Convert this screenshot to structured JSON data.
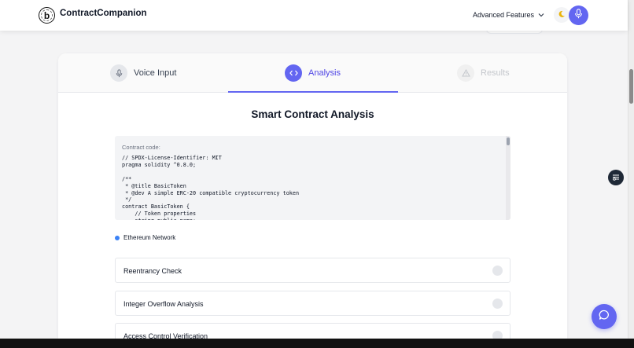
{
  "app": {
    "name": "ContractCompanion",
    "logo_letter": "b"
  },
  "header": {
    "advanced_features_label": "Advanced Features",
    "icons": [
      "chevron-down-icon",
      "moon-icon",
      "microphone-icon"
    ]
  },
  "tabs": [
    {
      "label": "Voice Input",
      "icon": "microphone-icon",
      "state": "completed"
    },
    {
      "label": "Analysis",
      "icon": "code-icon",
      "state": "active"
    },
    {
      "label": "Results",
      "icon": "warning-icon",
      "state": "disabled"
    }
  ],
  "main": {
    "title": "Smart Contract Analysis",
    "code_caption": "Contract code:",
    "code": "// SPDX-License-Identifier: MIT\npragma solidity ^0.8.0;\n\n/**\n * @title BasicToken\n * @dev A simple ERC-20 compatible cryptocurrency token\n */\ncontract BasicToken {\n    // Token properties\n    string public name;",
    "network": "Ethereum Network",
    "checks": [
      {
        "label": "Reentrancy Check"
      },
      {
        "label": "Integer Overflow Analysis"
      },
      {
        "label": "Access Control Verification"
      }
    ]
  },
  "colors": {
    "accent": "#6366f1",
    "network_dot": "#3b82f6"
  }
}
